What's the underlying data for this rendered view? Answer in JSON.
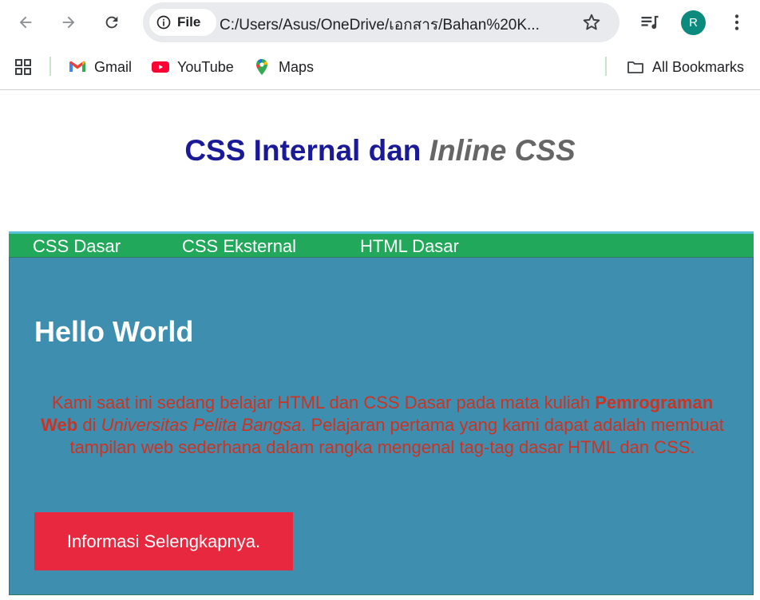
{
  "browser": {
    "site_chip_label": "File",
    "url": "C:/Users/Asus/OneDrive/เอกสาร/Bahan%20K...",
    "profile_initial": "R",
    "icons": [
      "back-icon",
      "forward-icon",
      "reload-icon",
      "info-icon",
      "star-icon",
      "media-control-icon",
      "kebab-menu-icon"
    ]
  },
  "bookmarks": {
    "items": [
      {
        "label": "Gmail",
        "icon": "gmail-icon"
      },
      {
        "label": "YouTube",
        "icon": "youtube-icon"
      },
      {
        "label": "Maps",
        "icon": "maps-icon"
      }
    ],
    "all_bookmarks_label": "All Bookmarks"
  },
  "page": {
    "title_part1": "CSS Internal dan ",
    "title_part2": "Inline CSS",
    "nav": [
      "CSS Dasar",
      "CSS Eksternal",
      "HTML Dasar"
    ],
    "heading": "Hello World",
    "para": {
      "p1": "Kami saat ini sedang belajar HTML dan CSS Dasar pada mata kuliah ",
      "bold": "Pemrograman Web",
      "p2": " di ",
      "italic": "Universitas Pelita Bangsa",
      "p3": ". Pelajaran pertama yang kami dapat adalah membuat tampilan web sederhana dalam rangka mengenal tag-tag dasar HTML dan CSS."
    },
    "button_label": "Informasi Selengkapnya."
  },
  "colors": {
    "title": "#1a1a99",
    "title_italic": "#666666",
    "navbar": "#22a85a",
    "navbar_top_border": "#5bc0de",
    "content_bg": "#3e8eb0",
    "paragraph": "#cc3322",
    "button": "#e8283f"
  }
}
